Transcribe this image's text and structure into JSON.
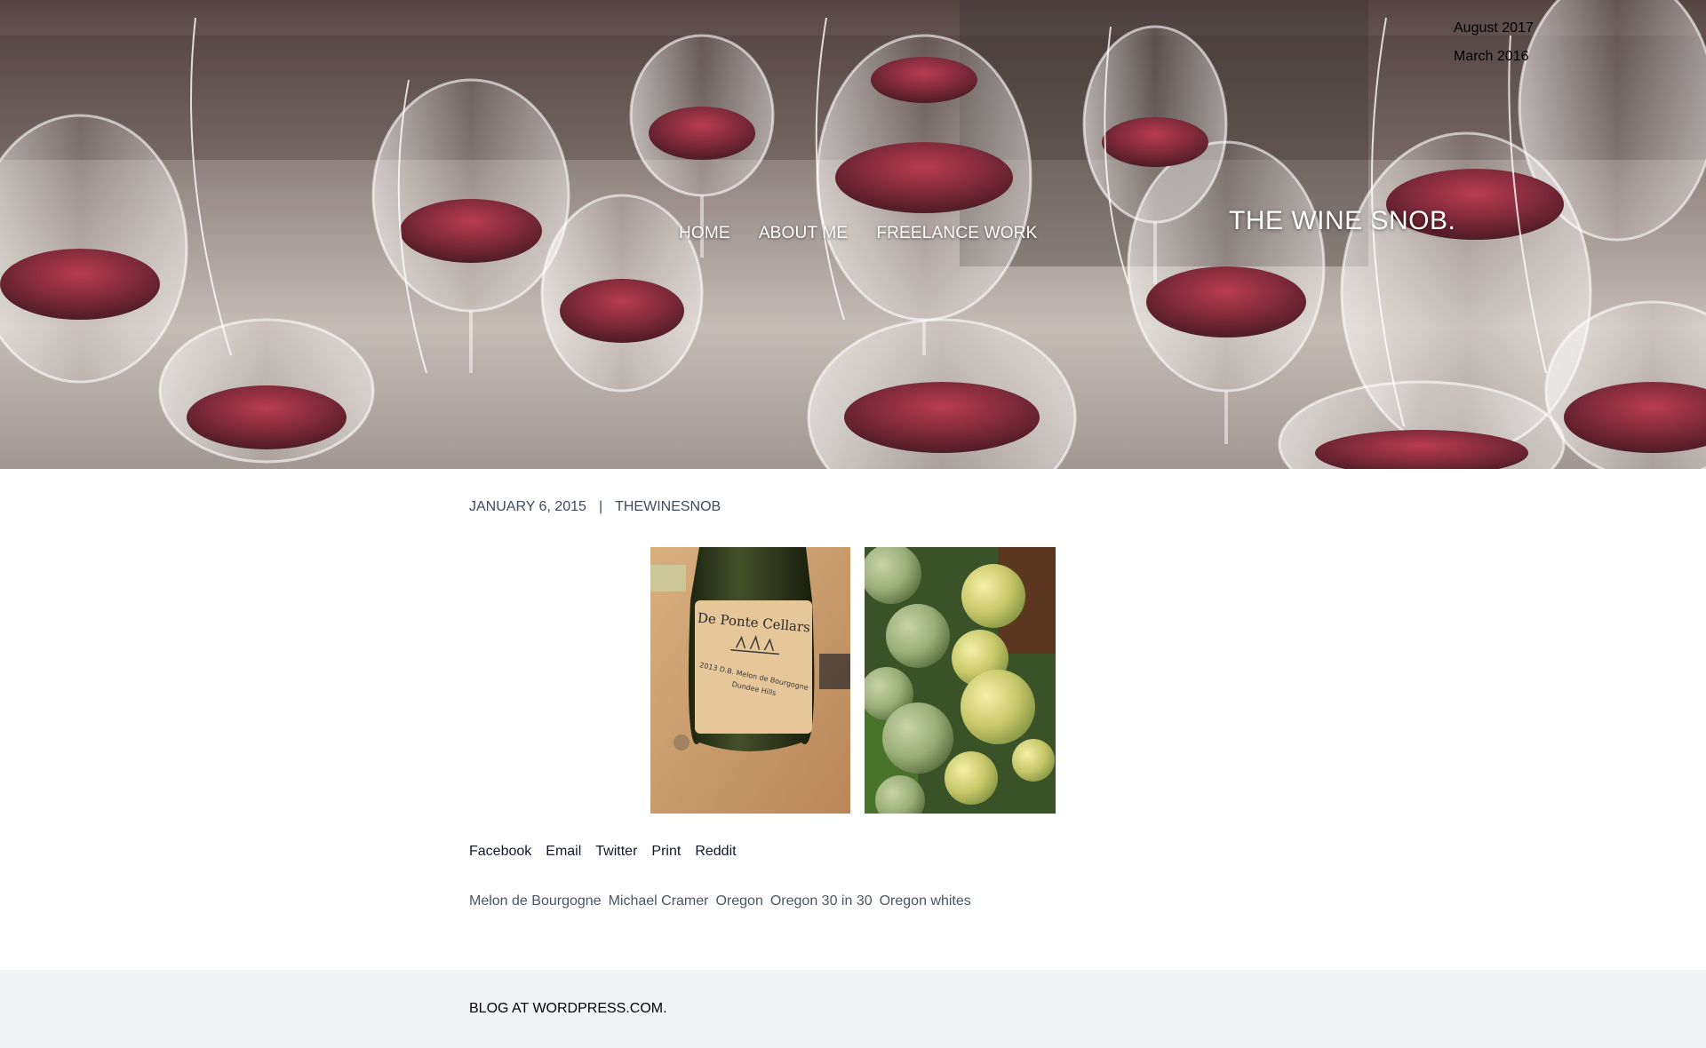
{
  "site": {
    "title": "THE WINE SNOB."
  },
  "archives": [
    "August 2017",
    "March 2016"
  ],
  "nav": [
    "HOME",
    "ABOUT ME",
    "FREELANCE WORK"
  ],
  "post": {
    "date": "JANUARY 6, 2015",
    "separator": "|",
    "author": "THEWINESNOB",
    "bottle_label_line1": "De Ponte Cellars",
    "bottle_label_line2": "2013 D.B. Melon de Bourgogne",
    "bottle_label_line3": "Dundee Hills"
  },
  "share": [
    "Facebook",
    "Email",
    "Twitter",
    "Print",
    "Reddit"
  ],
  "tags": [
    "Melon de Bourgogne",
    "Michael Cramer",
    "Oregon",
    "Oregon 30 in 30",
    "Oregon whites"
  ],
  "footer": {
    "credit": "BLOG AT WORDPRESS.COM."
  },
  "colors": {
    "footer_bg": "#f3f4f6",
    "meta_text": "#3f4a5a",
    "wine": "#7a1f2e"
  },
  "icons": {
    "hero": "wine-glasses-photo",
    "gallery_1": "wine-bottle-photo",
    "gallery_2": "grapes-photo"
  }
}
